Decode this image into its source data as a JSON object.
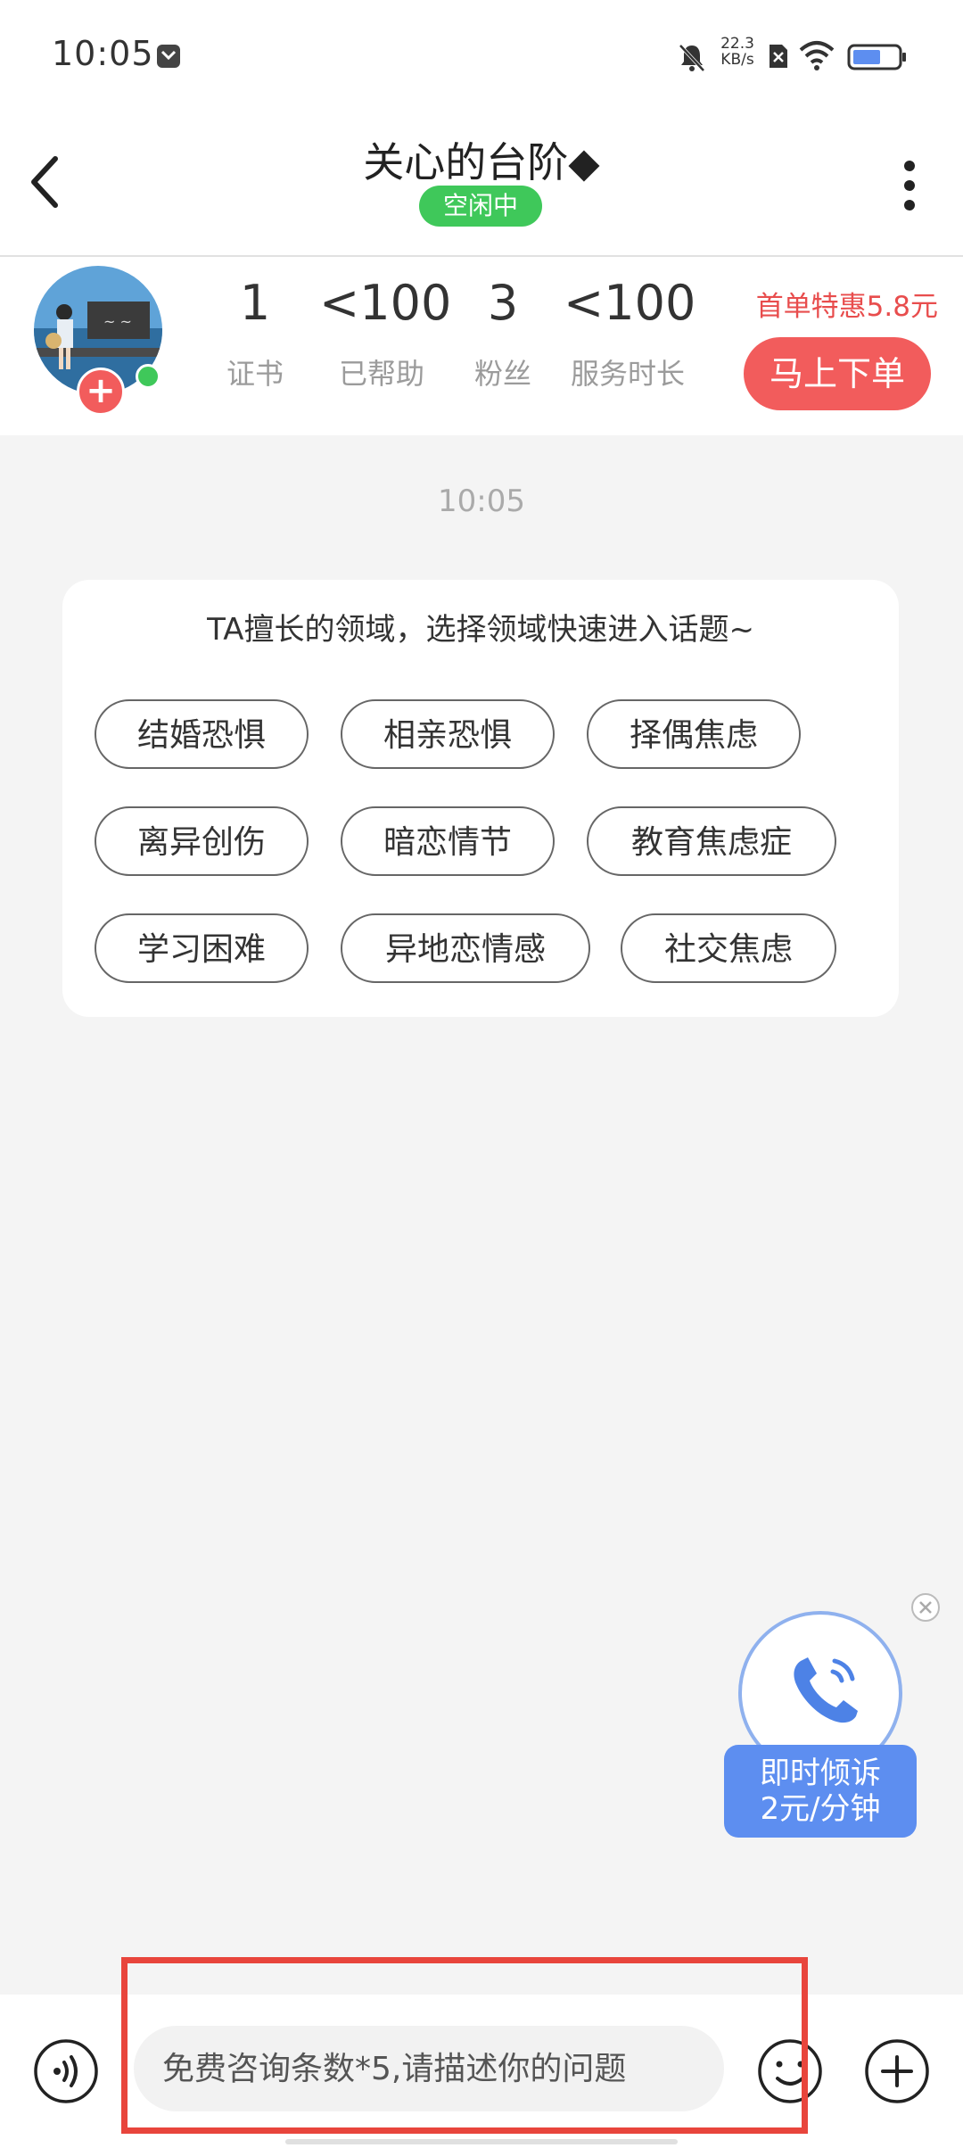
{
  "status_bar": {
    "time": "10:05",
    "net_speed_value": "22.3",
    "net_speed_unit": "KB/s"
  },
  "header": {
    "title": "关心的台阶◆",
    "status": "空闲中"
  },
  "profile": {
    "stats": [
      {
        "value": "1",
        "label": "证书"
      },
      {
        "value": "<100",
        "label": "已帮助"
      },
      {
        "value": "3",
        "label": "粉丝"
      },
      {
        "value": "<100",
        "label": "服务时长"
      }
    ],
    "promo": "首单特惠5.8元",
    "order_button": "马上下单"
  },
  "chat": {
    "timestamp": "10:05",
    "topic_card": {
      "title": "TA擅长的领域，选择领域快速进入话题~",
      "chips": [
        "结婚恐惧",
        "相亲恐惧",
        "择偶焦虑",
        "离异创伤",
        "暗恋情节",
        "教育焦虑症",
        "学习困难",
        "异地恋情感",
        "社交焦虑"
      ]
    }
  },
  "call_widget": {
    "line1": "即时倾诉",
    "line2": "2元/分钟"
  },
  "input_bar": {
    "placeholder": "免费咨询条数*5,请描述你的问题"
  },
  "colors": {
    "accent_red": "#f25c5c",
    "online_green": "#3fc85a",
    "call_blue": "#5d8ef0"
  }
}
